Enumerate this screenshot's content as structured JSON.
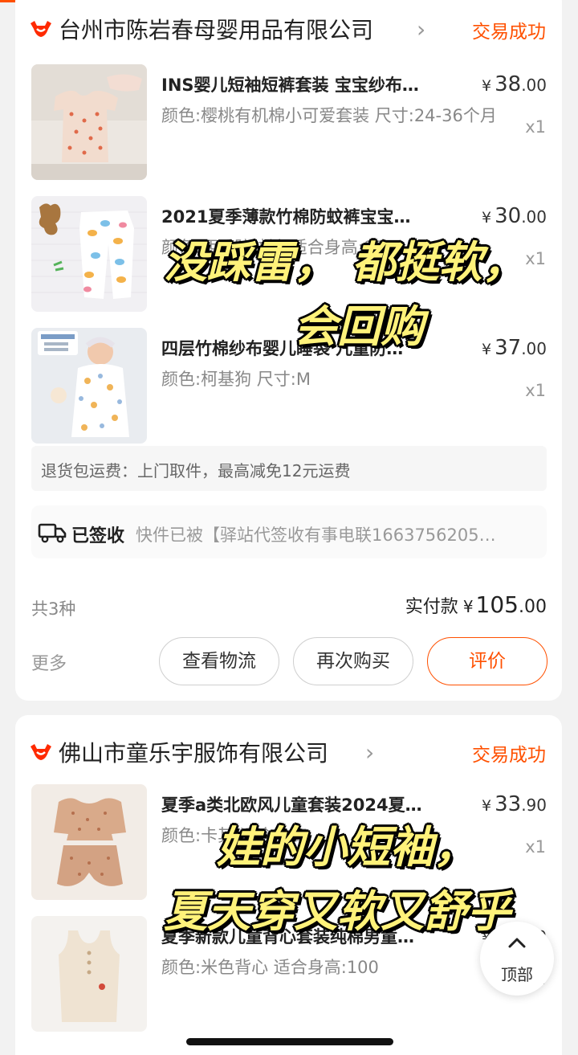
{
  "orders": [
    {
      "shop_name": "台州市陈岩春母婴用品有限公司",
      "status": "交易成功",
      "items": [
        {
          "title": "INS婴儿短袖短裤套装 宝宝纱布…",
          "sku": "颜色:樱桃有机棉小可爱套装 尺寸:24-36个月",
          "price_currency": "¥",
          "price_int": "38",
          "price_dec": ".00",
          "qty": "x1"
        },
        {
          "title": "2021夏季薄款竹棉防蚊裤宝宝…",
          "sku": "颜色:西瓜防蚊裤 适合身高:90",
          "price_currency": "¥",
          "price_int": "30",
          "price_dec": ".00",
          "qty": "x1"
        },
        {
          "title": "四层竹棉纱布婴儿睡袋 儿童防…",
          "sku": "颜色:柯基狗 尺寸:M",
          "price_currency": "¥",
          "price_int": "37",
          "price_dec": ".00",
          "qty": "x1"
        }
      ],
      "return_service": "退货包运费：上门取件，最高减免12元运费",
      "logistics_status": "已签收",
      "logistics_detail": "快件已被【驿站代签收有事电联1663756205…",
      "count_label": "共3种",
      "paid_label": "实付款",
      "paid_currency": "¥",
      "paid_int": "105",
      "paid_dec": ".00",
      "more_label": "更多",
      "buttons": [
        "查看物流",
        "再次购买",
        "评价"
      ]
    },
    {
      "shop_name": "佛山市童乐宇服饰有限公司",
      "status": "交易成功",
      "items": [
        {
          "title": "夏季a类北欧风儿童套装2024夏…",
          "sku": "颜色:卡其 适合身高:",
          "price_currency": "¥",
          "price_int": "33",
          "price_dec": ".90",
          "qty": "x1"
        },
        {
          "title": "夏季新款儿童背心套装纯棉男童…",
          "sku": "颜色:米色背心 适合身高:100",
          "price_currency": "¥",
          "price_int": "16",
          "price_dec": ".90",
          "qty": "x1"
        }
      ]
    }
  ],
  "overlay_captions": [
    "没踩雷， 都挺软，",
    "会回购",
    "娃的小短袖，",
    "夏天穿又软又舒乎"
  ],
  "back_to_top": "顶部",
  "colors": {
    "accent": "#ff5000",
    "caption": "#fff27a"
  },
  "icons": [
    "shop-badge-icon",
    "chevron-right-icon",
    "truck-icon",
    "chevron-up-icon"
  ]
}
